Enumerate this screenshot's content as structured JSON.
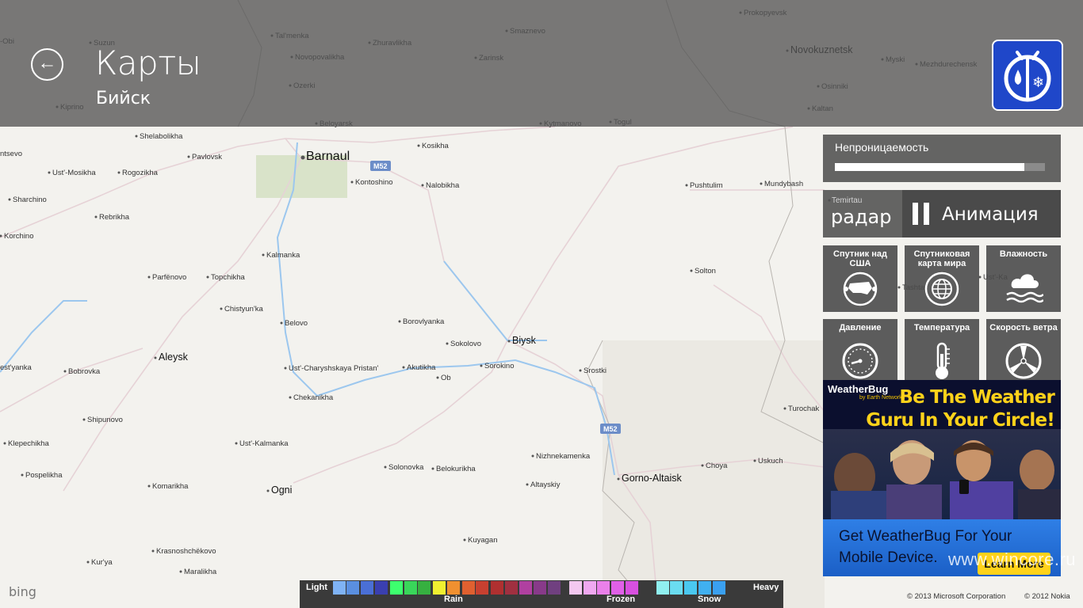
{
  "header": {
    "back_label": "Back",
    "title": "Карты",
    "subtitle": "Бийск"
  },
  "map": {
    "cities_large": [
      "Barnaul"
    ],
    "cities_medium": [
      "Biysk",
      "Novokuznetsk",
      "Gorno-Altaisk",
      "Ogni",
      "Aleysk"
    ],
    "cities_small": [
      "Prokopyevsk",
      "Suzun",
      "Tal'menka",
      "Zhuravlikha",
      "Smaznevo",
      "Zarinsk",
      "Novopovalikha",
      "Myski",
      "Mezhdurechensk",
      "Ozerki",
      "Osinniki",
      "Kiprino",
      "Kaltan",
      "Beloyarsk",
      "Kytmanovo",
      "Togul",
      "Shelabolikha",
      "Kosikha",
      "Pavlovsk",
      "Ust'-Mosikha",
      "Rogozikha",
      "Kontoshino",
      "Nalobikha",
      "Pushtulim",
      "Mundybash",
      "Sharchino",
      "Rebrikha",
      "Korchino",
      "Kalmanka",
      "Parfënovo",
      "Topchikha",
      "Solton",
      "Chistyun'ka",
      "Belovo",
      "Borovlyanka",
      "Sokolovo",
      "Ust'-Charyshskaya Pristan'",
      "Akutikha",
      "Sorokino",
      "Srostki",
      "Bobrovka",
      "Chekanikha",
      "Shipunovo",
      "Turochak",
      "Klepechikha",
      "Ust'-Kalmanka",
      "Nizhnekamenka",
      "Solonovka",
      "Belokurikha",
      "Choya",
      "Uskuch",
      "Pospelikha",
      "Komarikha",
      "Altayskiy",
      "Kuyagan",
      "Krasnoshchëkovo",
      "Kur'ya",
      "Maralikha",
      "ntsevo",
      "-Obi",
      "est'yanka",
      "Tashta",
      "Ust'-Ka",
      "Ob",
      "Bobrovka",
      "Temirtau"
    ],
    "road_labels": [
      "M52",
      "M52"
    ]
  },
  "panel": {
    "opacity_label": "Непроницаемость",
    "opacity_value": 0.9,
    "radar_small": "Temirtau",
    "radar_label": "радар",
    "animation_label": "Анимация",
    "tiles": [
      {
        "label": "Спутник над США",
        "icon": "satellite-usa-icon"
      },
      {
        "label": "Спутниковая карта мира",
        "icon": "satellite-world-icon"
      },
      {
        "label": "Влажность",
        "icon": "humidity-icon"
      },
      {
        "label": "Давление",
        "icon": "pressure-gauge-icon"
      },
      {
        "label": "Температура",
        "icon": "thermometer-icon"
      },
      {
        "label": "Скорость ветра",
        "icon": "wind-turbine-icon"
      }
    ]
  },
  "ad": {
    "brand": "WeatherBug",
    "brand_sub": "by Earth Networks",
    "headline_1": "Be The Weather",
    "headline_2": "Guru In Your Circle!",
    "cta_1": "Get WeatherBug For Your",
    "cta_2": "Mobile Device.",
    "button": "Learn More"
  },
  "legend": {
    "light": "Light",
    "heavy": "Heavy",
    "rain": "Rain",
    "frozen": "Frozen",
    "snow": "Snow",
    "colors": [
      "#7fb3f5",
      "#5a8fe0",
      "#4a6fd6",
      "#3a3fb0",
      "#3dff6e",
      "#39d65a",
      "#36b040",
      "#f0f030",
      "#f09030",
      "#e06030",
      "#c84030",
      "#b03030",
      "#a03040",
      "#b040a0",
      "#883a8a",
      "#704080",
      "#f4c8f0",
      "#f0a8f0",
      "#ea80ea",
      "#e060e8",
      "#d850e0",
      "#90f0f0",
      "#6adcf0",
      "#4ac8f0",
      "#40b0f0",
      "#3aa0f0"
    ]
  },
  "footer": {
    "bing": "bing",
    "copyright_ms": "© 2013 Microsoft Corporation",
    "copyright_nokia": "© 2012 Nokia",
    "watermark": "www.wincore.ru"
  },
  "colors": {
    "header_bg": "#555555",
    "app_logo": "#1f47c9",
    "ad_yellow": "#ffd21a",
    "ad_blue": "#2f7fe6"
  }
}
